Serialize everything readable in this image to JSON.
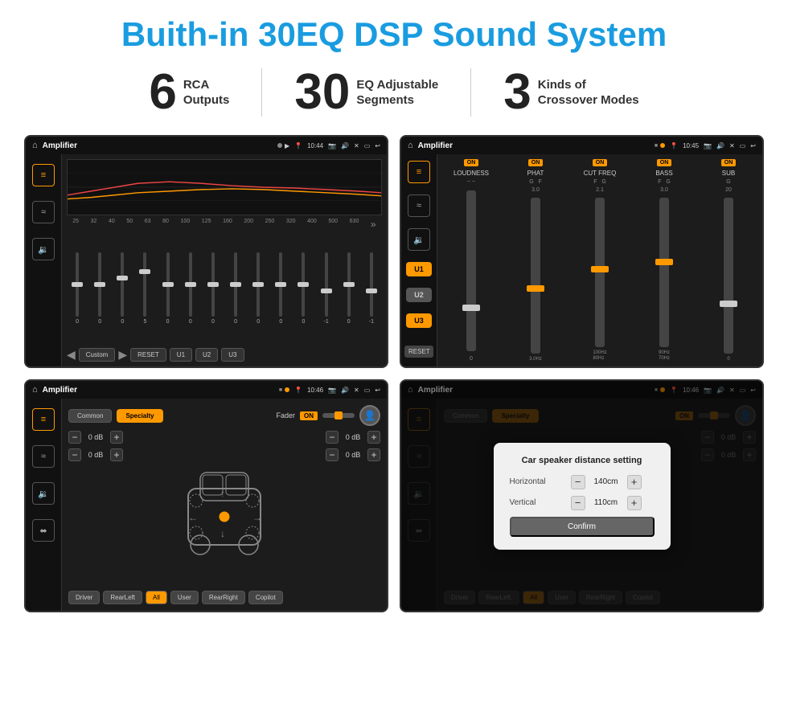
{
  "page": {
    "title": "Buith-in 30EQ DSP Sound System",
    "title_color": "#1a9ce0"
  },
  "stats": [
    {
      "number": "6",
      "label_line1": "RCA",
      "label_line2": "Outputs"
    },
    {
      "number": "30",
      "label_line1": "EQ Adjustable",
      "label_line2": "Segments"
    },
    {
      "number": "3",
      "label_line1": "Kinds of",
      "label_line2": "Crossover Modes"
    }
  ],
  "screen1": {
    "status_bar": {
      "app_name": "Amplifier",
      "time": "10:44"
    },
    "eq_freqs": [
      "25",
      "32",
      "40",
      "50",
      "63",
      "80",
      "100",
      "125",
      "160",
      "200",
      "250",
      "320",
      "400",
      "500",
      "630"
    ],
    "eq_vals": [
      "0",
      "0",
      "0",
      "5",
      "0",
      "0",
      "0",
      "0",
      "0",
      "0",
      "0",
      "-1",
      "0",
      "-1"
    ],
    "custom_label": "Custom",
    "reset_label": "RESET",
    "u1_label": "U1",
    "u2_label": "U2",
    "u3_label": "U3"
  },
  "screen2": {
    "status_bar": {
      "app_name": "Amplifier",
      "time": "10:45"
    },
    "channels": [
      {
        "name": "LOUDNESS",
        "on": true
      },
      {
        "name": "PHAT",
        "on": true
      },
      {
        "name": "CUT FREQ",
        "on": true
      },
      {
        "name": "BASS",
        "on": true
      },
      {
        "name": "SUB",
        "on": true
      }
    ],
    "u_buttons": [
      "U1",
      "U2",
      "U3"
    ],
    "reset_label": "RESET"
  },
  "screen3": {
    "status_bar": {
      "app_name": "Amplifier",
      "time": "10:46"
    },
    "modes": [
      "Common",
      "Specialty"
    ],
    "active_mode": "Specialty",
    "fader_label": "Fader",
    "fader_on": true,
    "channels_left": [
      {
        "db": "0 dB"
      },
      {
        "db": "0 dB"
      }
    ],
    "channels_right": [
      {
        "db": "0 dB"
      },
      {
        "db": "0 dB"
      }
    ],
    "bottom_btns": [
      "Driver",
      "RearLeft",
      "All",
      "User",
      "RearRight",
      "Copilot"
    ]
  },
  "screen4": {
    "status_bar": {
      "app_name": "Amplifier",
      "time": "10:46"
    },
    "modes": [
      "Common",
      "Specialty"
    ],
    "active_mode": "Specialty",
    "fader_on": true,
    "channels_right": [
      {
        "db": "0 dB"
      },
      {
        "db": "0 dB"
      }
    ],
    "dialog": {
      "title": "Car speaker distance setting",
      "horizontal_label": "Horizontal",
      "horizontal_value": "140cm",
      "vertical_label": "Vertical",
      "vertical_value": "110cm",
      "confirm_label": "Confirm"
    },
    "bottom_btns": [
      "Driver",
      "RearLeft.",
      "All",
      "User",
      "RearRight",
      "Copilot"
    ]
  }
}
